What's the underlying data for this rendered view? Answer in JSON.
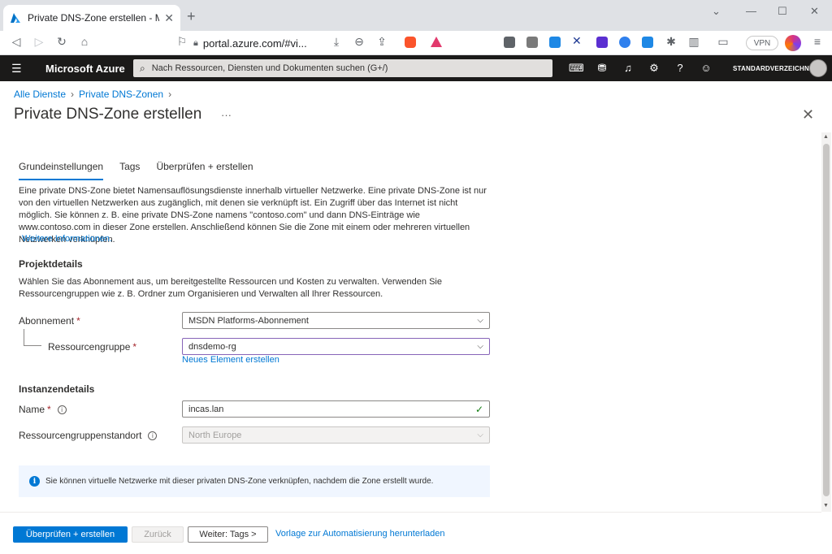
{
  "browser": {
    "tab_title": "Private DNS-Zone erstellen - Microsoft",
    "url": "portal.azure.com/#vi...",
    "vpn_label": "VPN"
  },
  "azure": {
    "brand": "Microsoft Azure",
    "search_placeholder": "Nach Ressourcen, Diensten und Dokumenten suchen (G+/)",
    "directory": "STANDARDVERZEICHNIS"
  },
  "breadcrumb": [
    "Alle Dienste",
    "Private DNS-Zonen"
  ],
  "page": {
    "title": "Private DNS-Zone erstellen",
    "more": "···"
  },
  "tabs": [
    {
      "label": "Grundeinstellungen",
      "active": true
    },
    {
      "label": "Tags",
      "active": false
    },
    {
      "label": "Überprüfen + erstellen",
      "active": false
    }
  ],
  "intro": {
    "text": "Eine private DNS-Zone bietet Namensauflösungsdienste innerhalb virtueller Netzwerke. Eine private DNS-Zone ist nur von den virtuellen Netzwerken aus zugänglich, mit denen sie verknüpft ist. Ein Zugriff über das Internet ist nicht möglich. Sie können z. B. eine private DNS-Zone namens \"contoso.com\" und dann DNS-Einträge wie www.contoso.com in dieser Zone erstellen. Anschließend können Sie die Zone mit einem oder mehreren virtuellen Netzwerken verknüpfen.",
    "link": "Weitere Informationen."
  },
  "project": {
    "heading": "Projektdetails",
    "text": "Wählen Sie das Abonnement aus, um bereitgestellte Ressourcen und Kosten zu verwalten. Verwenden Sie Ressourcengruppen wie z. B. Ordner zum Organisieren und Verwalten all Ihrer Ressourcen.",
    "subscription_label": "Abonnement",
    "subscription_value": "MSDN Platforms-Abonnement",
    "rg_label": "Ressourcengruppe",
    "rg_value": "dnsdemo-rg",
    "rg_new_link": "Neues Element erstellen"
  },
  "instance": {
    "heading": "Instanzendetails",
    "name_label": "Name",
    "name_value": "incas.lan",
    "location_label": "Ressourcengruppenstandort",
    "location_value": "North Europe"
  },
  "infobar": {
    "text": "Sie können virtuelle Netzwerke mit dieser privaten DNS-Zone verknüpfen, nachdem die Zone erstellt wurde."
  },
  "footer": {
    "review_create": "Überprüfen + erstellen",
    "back": "Zurück",
    "next": "Weiter: Tags >",
    "template_link": "Vorlage zur Automatisierung herunterladen"
  }
}
